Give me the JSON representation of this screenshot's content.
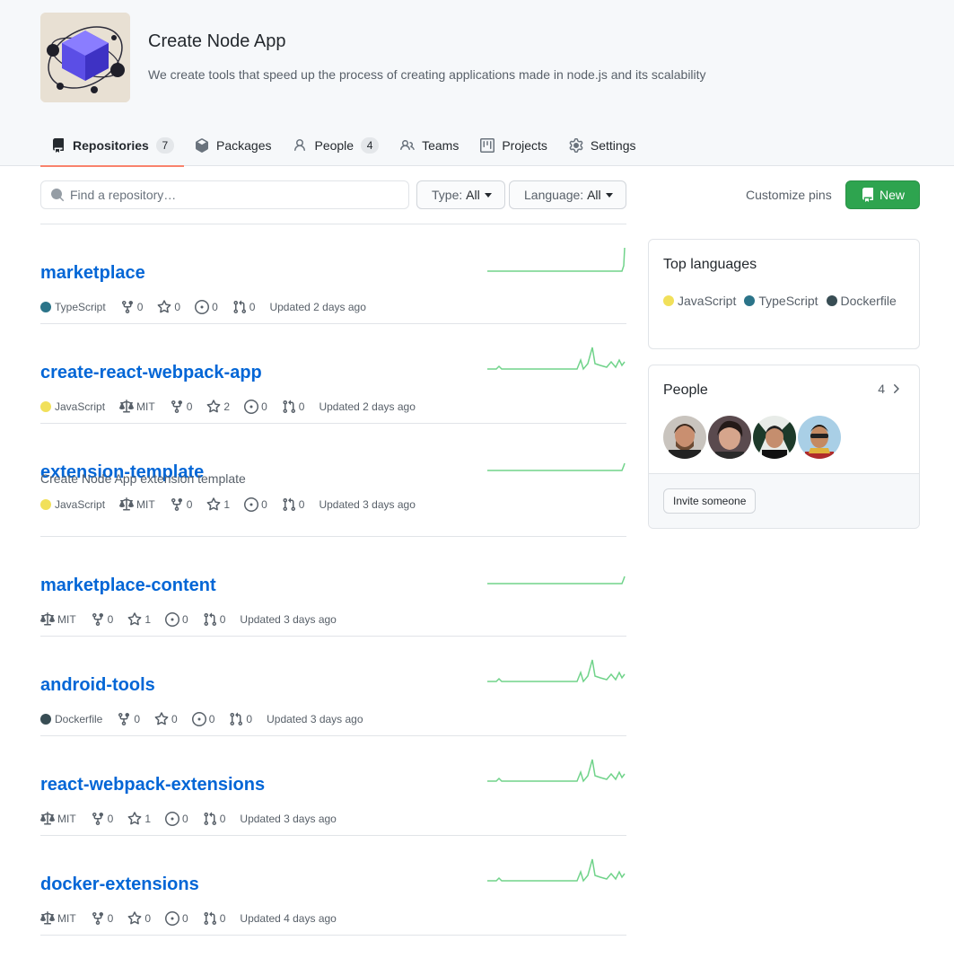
{
  "org": {
    "name": "Create Node App",
    "description": "We create tools that speed up the process of creating applications made in node.js and its scalability"
  },
  "tabs": [
    {
      "label": "Repositories",
      "count": "7",
      "icon": "repo-icon",
      "active": true
    },
    {
      "label": "Packages",
      "icon": "package-icon"
    },
    {
      "label": "People",
      "count": "4",
      "icon": "person-icon"
    },
    {
      "label": "Teams",
      "icon": "people-icon"
    },
    {
      "label": "Projects",
      "icon": "project-icon"
    },
    {
      "label": "Settings",
      "icon": "gear-icon"
    }
  ],
  "filters": {
    "search_placeholder": "Find a repository…",
    "type_label": "Type:",
    "type_value": "All",
    "language_label": "Language:",
    "language_value": "All",
    "customize_pins": "Customize pins",
    "new_button": "New"
  },
  "colors": {
    "TypeScript": "#2b7489",
    "JavaScript": "#f1e05a",
    "Dockerfile": "#384d54",
    "accent_tab": "#f9826c",
    "link": "#0366d6",
    "new_button": "#2ea44f",
    "sparkline": "#40c463"
  },
  "repos": [
    {
      "name": "marketplace",
      "description": "",
      "language": "TypeScript",
      "license": "",
      "forks": "0",
      "stars": "0",
      "issues": "0",
      "prs": "0",
      "updated": "Updated 2 days ago"
    },
    {
      "name": "create-react-webpack-app",
      "description": "",
      "language": "JavaScript",
      "license": "MIT",
      "forks": "0",
      "stars": "2",
      "issues": "0",
      "prs": "0",
      "updated": "Updated 2 days ago"
    },
    {
      "name": "extension-template",
      "description": "Create Node App extension template",
      "language": "JavaScript",
      "license": "MIT",
      "forks": "0",
      "stars": "1",
      "issues": "0",
      "prs": "0",
      "updated": "Updated 3 days ago"
    },
    {
      "name": "marketplace-content",
      "description": "",
      "language": "",
      "license": "MIT",
      "forks": "0",
      "stars": "1",
      "issues": "0",
      "prs": "0",
      "updated": "Updated 3 days ago"
    },
    {
      "name": "android-tools",
      "description": "",
      "language": "Dockerfile",
      "license": "",
      "forks": "0",
      "stars": "0",
      "issues": "0",
      "prs": "0",
      "updated": "Updated 3 days ago"
    },
    {
      "name": "react-webpack-extensions",
      "description": "",
      "language": "",
      "license": "MIT",
      "forks": "0",
      "stars": "1",
      "issues": "0",
      "prs": "0",
      "updated": "Updated 3 days ago"
    },
    {
      "name": "docker-extensions",
      "description": "",
      "language": "",
      "license": "MIT",
      "forks": "0",
      "stars": "0",
      "issues": "0",
      "prs": "0",
      "updated": "Updated 4 days ago"
    }
  ],
  "top_languages": {
    "title": "Top languages",
    "items": [
      "JavaScript",
      "TypeScript",
      "Dockerfile"
    ]
  },
  "people": {
    "title": "People",
    "count": "4",
    "invite_label": "Invite someone"
  }
}
